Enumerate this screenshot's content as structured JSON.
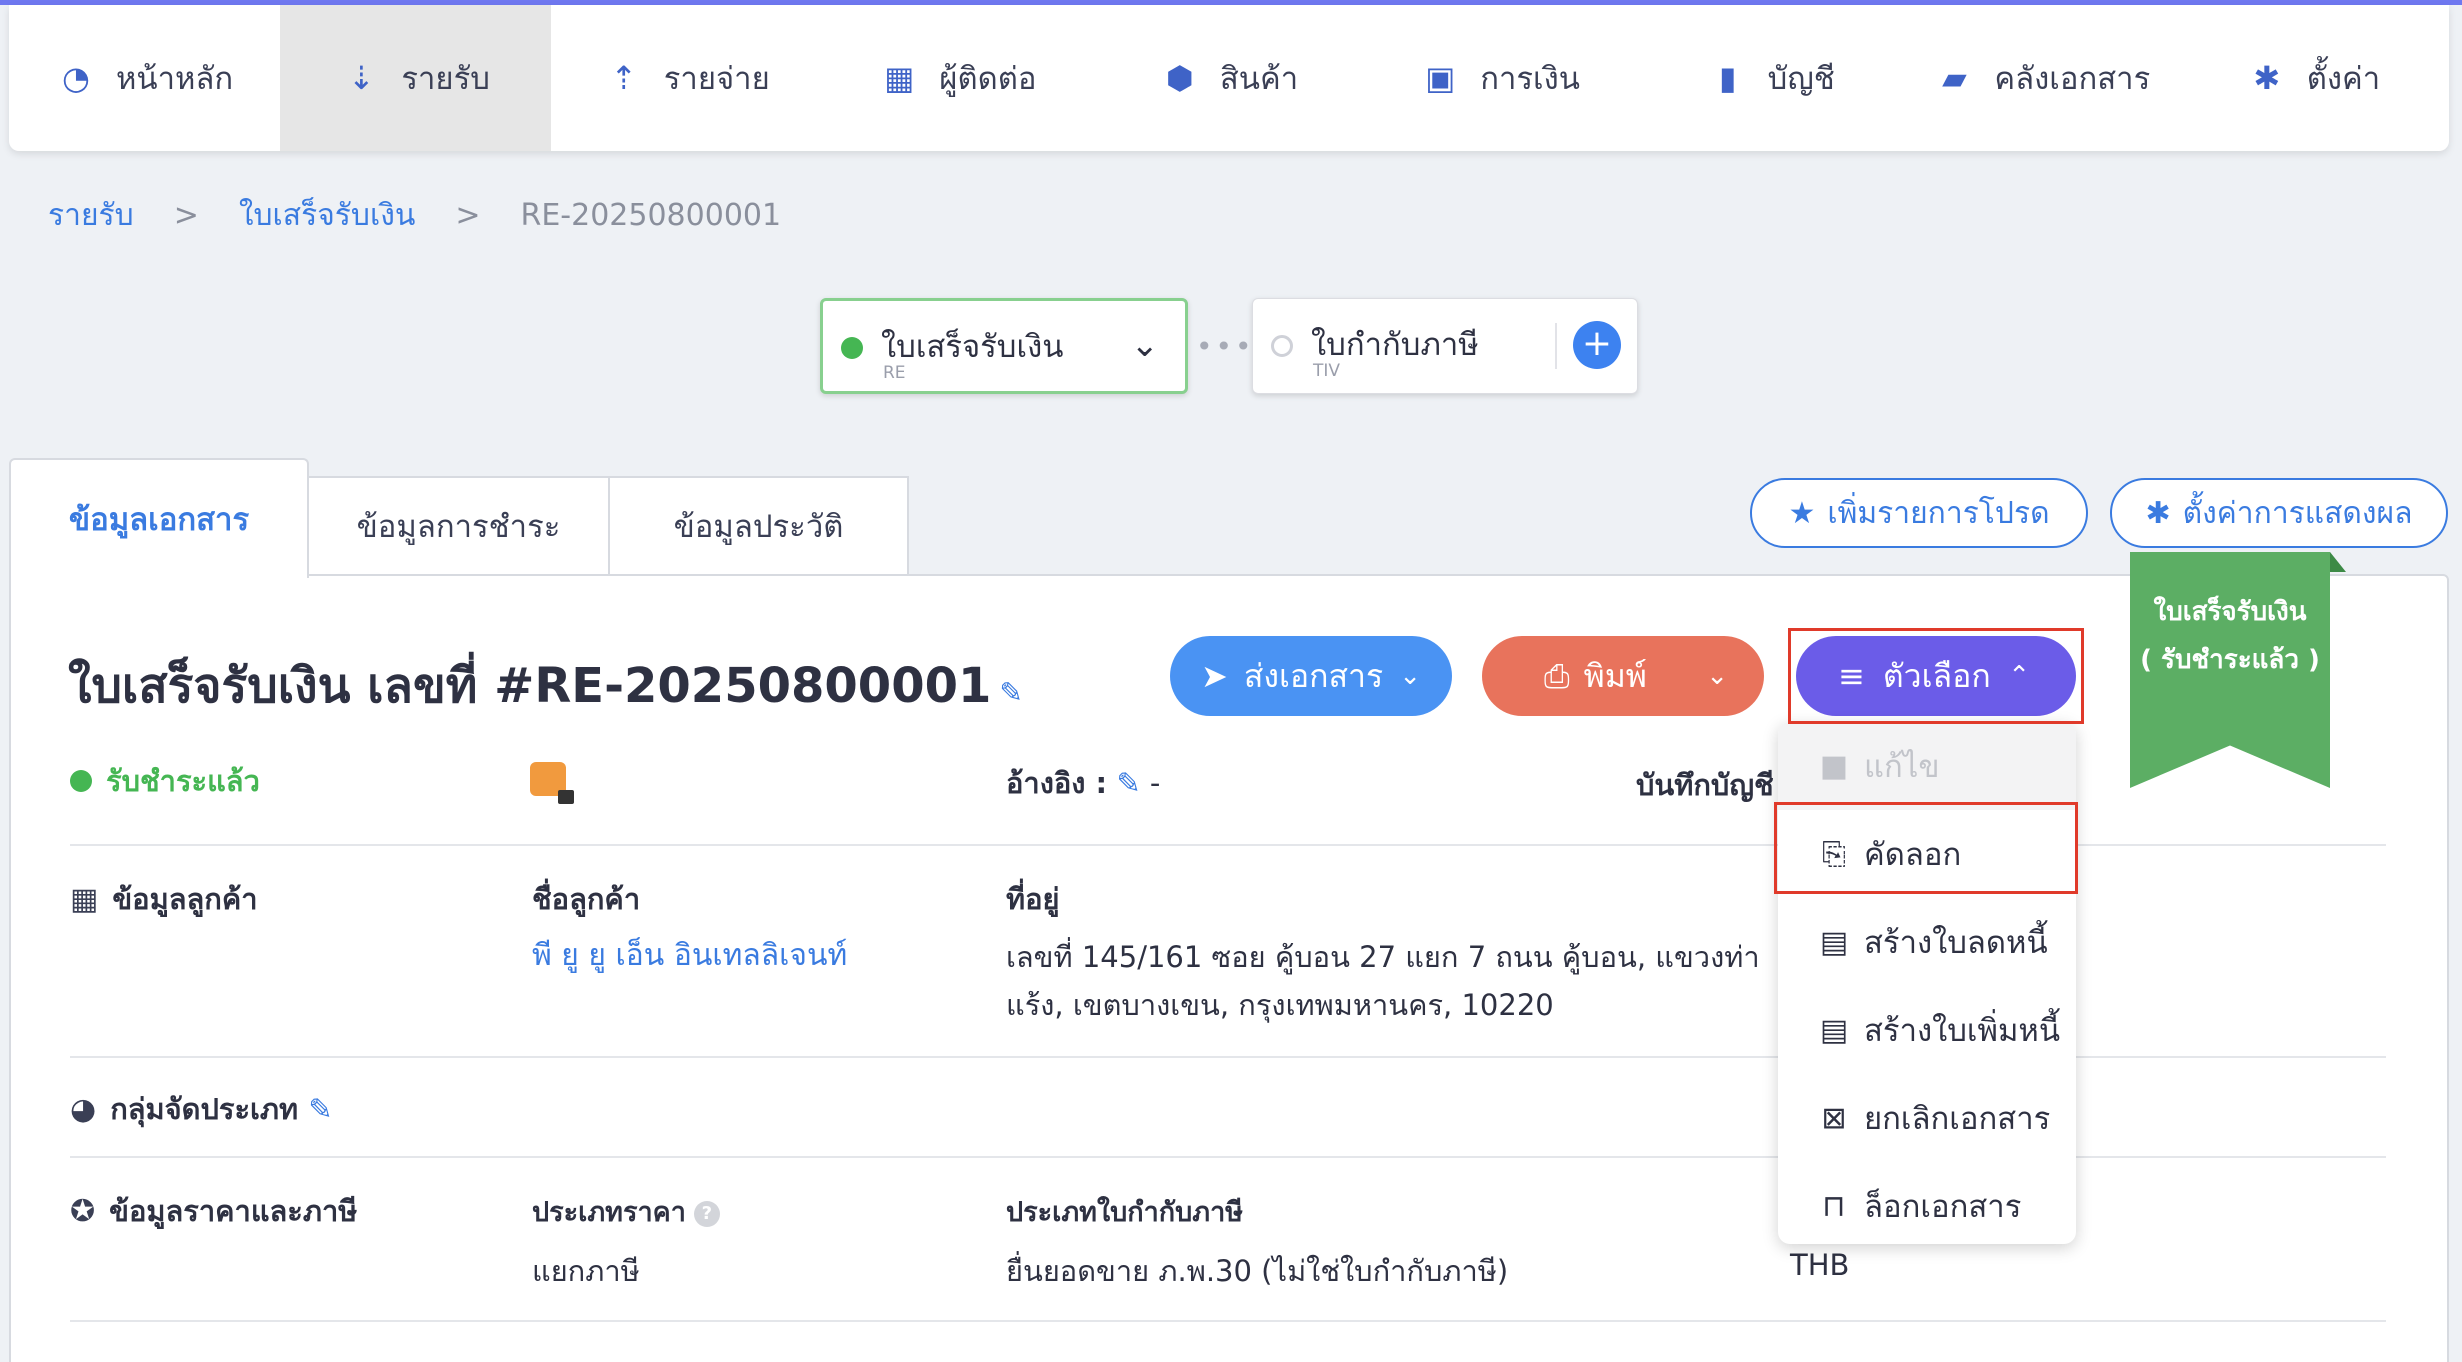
{
  "nav": {
    "items": [
      {
        "label": "หน้าหลัก",
        "icon": "dashboard-icon",
        "glyph": "◔"
      },
      {
        "label": "รายรับ",
        "icon": "income-icon",
        "glyph": "⇣"
      },
      {
        "label": "รายจ่าย",
        "icon": "expense-icon",
        "glyph": "⇡"
      },
      {
        "label": "ผู้ติดต่อ",
        "icon": "contacts-icon",
        "glyph": "▦"
      },
      {
        "label": "สินค้า",
        "icon": "product-box-icon",
        "glyph": "⬢"
      },
      {
        "label": "การเงิน",
        "icon": "money-icon",
        "glyph": "▣"
      },
      {
        "label": "บัญชี",
        "icon": "ledger-icon",
        "glyph": "▮"
      },
      {
        "label": "คลังเอกสาร",
        "icon": "folder-icon",
        "glyph": "▰"
      },
      {
        "label": "ตั้งค่า",
        "icon": "settings-gear-icon",
        "glyph": "✱"
      }
    ],
    "active_index": 1
  },
  "breadcrumb": {
    "items": [
      "รายรับ",
      "ใบเสร็จรับเงิน"
    ],
    "separator": ">",
    "current": "RE-20250800001"
  },
  "flow": {
    "current": {
      "title": "ใบเสร็จรับเงิน",
      "code": "RE",
      "chevron": "⌄"
    },
    "connector": "•••",
    "next": {
      "title": "ใบกำกับภาษี",
      "code": "TIV",
      "plus": "+"
    }
  },
  "tabs": [
    "ข้อมูลเอกสาร",
    "ข้อมูลการชำระ",
    "ข้อมูลประวัติ"
  ],
  "pills": {
    "favorite": {
      "label": "เพิ่มรายการโปรด",
      "glyph": "★"
    },
    "display_settings": {
      "label": "ตั้งค่าการแสดงผล",
      "glyph": "✱"
    }
  },
  "document": {
    "title": "ใบเสร็จรับเงิน เลขที่ #RE-20250800001",
    "edit_glyph": "✎"
  },
  "actions": {
    "send": {
      "label": "ส่งเอกสาร",
      "glyph": "➤",
      "caret": "⌄"
    },
    "print": {
      "label": "พิมพ์",
      "glyph": "⎙",
      "caret": "⌄"
    },
    "options": {
      "label": "ตัวเลือก",
      "glyph": "≡",
      "caret": "⌃"
    }
  },
  "ribbon": {
    "line1": "ใบเสร็จรับเงิน",
    "line2": "( รับชำระแล้ว )"
  },
  "status": {
    "label": "รับชำระแล้ว",
    "color": "#45b653"
  },
  "reference": {
    "label": "อ้างอิง :",
    "value": "-"
  },
  "accounting": {
    "label": "บันทึกบัญชี :"
  },
  "customer": {
    "section": "ข้อมูลลูกค้า",
    "name_label": "ชื่อลูกค้า",
    "name_value": "พี ยู ยู เอ็น อินเทลลิเจนท์",
    "address_label": "ที่อยู่",
    "address_line1": "เลขที่ 145/161 ซอย คู้บอน 27 แยก 7 ถนน คู้บอน, แขวงท่า",
    "address_line2": "แร้ง, เขตบางเขน, กรุงเทพมหานคร, 10220"
  },
  "category": {
    "section": "กลุ่มจัดประเภท"
  },
  "pricing": {
    "section": "ข้อมูลราคาและภาษี",
    "price_type_label": "ประเภทราคา",
    "price_type_value": "แยกภาษี",
    "tax_invoice_label": "ประเภทใบกำกับภาษี",
    "tax_invoice_value": "ยื่นยอดขาย ภ.พ.30 (ไม่ใช่ใบกำกับภาษี)",
    "currency_value": "THB"
  },
  "menu": {
    "items": [
      {
        "label": "แก้ไข",
        "icon": "lock-icon",
        "glyph": "🔒",
        "disabled": true
      },
      {
        "label": "คัดลอก",
        "icon": "copy-icon",
        "glyph": "⎘",
        "disabled": false
      },
      {
        "label": "สร้างใบลดหนี้",
        "icon": "document-icon",
        "glyph": "▤",
        "disabled": false
      },
      {
        "label": "สร้างใบเพิ่มหนี้",
        "icon": "document-icon",
        "glyph": "▤",
        "disabled": false
      },
      {
        "label": "ยกเลิกเอกสาร",
        "icon": "cancel-document-icon",
        "glyph": "⊠",
        "disabled": false
      },
      {
        "label": "ล็อกเอกสาร",
        "icon": "lock-icon",
        "glyph": "⊓",
        "disabled": false
      }
    ]
  },
  "colors": {
    "accent_blue": "#3a7be0",
    "options_purple": "#6b5ce8",
    "print_orange": "#e8735c",
    "send_blue": "#4a93f3",
    "paid_green": "#45b653",
    "highlight_red": "#e03a2a"
  }
}
